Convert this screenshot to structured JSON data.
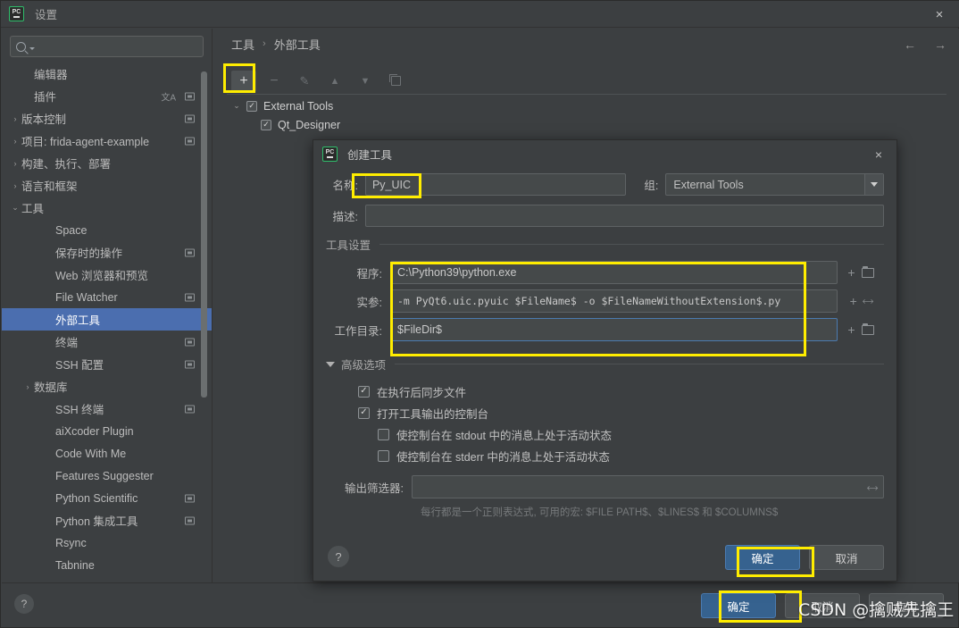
{
  "window": {
    "title": "设置",
    "logo_text": "PC",
    "close_icon": "×"
  },
  "search": {
    "value": "",
    "placeholder": ""
  },
  "sidebar": {
    "items": [
      {
        "label": "编辑器",
        "arrow": "",
        "indent": 1,
        "copy": false,
        "lang": false,
        "selected": false
      },
      {
        "label": "插件",
        "arrow": "",
        "indent": 1,
        "copy": true,
        "lang": true,
        "selected": false
      },
      {
        "label": "版本控制",
        "arrow": "›",
        "indent": 0,
        "copy": true,
        "lang": false,
        "selected": false
      },
      {
        "label": "项目: frida-agent-example",
        "arrow": "›",
        "indent": 0,
        "copy": true,
        "lang": false,
        "selected": false
      },
      {
        "label": "构建、执行、部署",
        "arrow": "›",
        "indent": 0,
        "copy": false,
        "lang": false,
        "selected": false
      },
      {
        "label": "语言和框架",
        "arrow": "›",
        "indent": 0,
        "copy": false,
        "lang": false,
        "selected": false
      },
      {
        "label": "工具",
        "arrow": "⌄",
        "indent": 0,
        "copy": false,
        "lang": false,
        "selected": false
      },
      {
        "label": "Space",
        "arrow": "",
        "indent": 2,
        "copy": false,
        "lang": false,
        "selected": false
      },
      {
        "label": "保存时的操作",
        "arrow": "",
        "indent": 2,
        "copy": true,
        "lang": false,
        "selected": false
      },
      {
        "label": "Web 浏览器和预览",
        "arrow": "",
        "indent": 2,
        "copy": false,
        "lang": false,
        "selected": false
      },
      {
        "label": "File Watcher",
        "arrow": "",
        "indent": 2,
        "copy": true,
        "lang": false,
        "selected": false
      },
      {
        "label": "外部工具",
        "arrow": "",
        "indent": 2,
        "copy": false,
        "lang": false,
        "selected": true
      },
      {
        "label": "终端",
        "arrow": "",
        "indent": 2,
        "copy": true,
        "lang": false,
        "selected": false
      },
      {
        "label": "SSH 配置",
        "arrow": "",
        "indent": 2,
        "copy": true,
        "lang": false,
        "selected": false
      },
      {
        "label": "数据库",
        "arrow": "›",
        "indent": 1,
        "copy": false,
        "lang": false,
        "selected": false
      },
      {
        "label": "SSH 终端",
        "arrow": "",
        "indent": 2,
        "copy": true,
        "lang": false,
        "selected": false
      },
      {
        "label": "aiXcoder Plugin",
        "arrow": "",
        "indent": 2,
        "copy": false,
        "lang": false,
        "selected": false
      },
      {
        "label": "Code With Me",
        "arrow": "",
        "indent": 2,
        "copy": false,
        "lang": false,
        "selected": false
      },
      {
        "label": "Features Suggester",
        "arrow": "",
        "indent": 2,
        "copy": false,
        "lang": false,
        "selected": false
      },
      {
        "label": "Python Scientific",
        "arrow": "",
        "indent": 2,
        "copy": true,
        "lang": false,
        "selected": false
      },
      {
        "label": "Python 集成工具",
        "arrow": "",
        "indent": 2,
        "copy": true,
        "lang": false,
        "selected": false
      },
      {
        "label": "Rsync",
        "arrow": "",
        "indent": 2,
        "copy": false,
        "lang": false,
        "selected": false
      },
      {
        "label": "Tabnine",
        "arrow": "",
        "indent": 2,
        "copy": false,
        "lang": false,
        "selected": false
      }
    ]
  },
  "breadcrumb": {
    "parent": "工具",
    "separator": "›",
    "current": "外部工具",
    "back_icon": "←",
    "forward_icon": "→"
  },
  "toolbar": {
    "add": "+",
    "remove": "−",
    "edit": "✎",
    "up": "▲",
    "down": "▼",
    "copy_tooltip": "copy-icon"
  },
  "tools_tree": {
    "group": {
      "label": "External Tools",
      "checked": true,
      "arrow": "⌄",
      "check_glyph": "✓"
    },
    "children": [
      {
        "label": "Qt_Designer",
        "checked": true,
        "check_glyph": "✓"
      }
    ]
  },
  "window_footer": {
    "help": "?",
    "ok": "确定",
    "cancel": "取消",
    "apply": "应用"
  },
  "dialog": {
    "title": "创建工具",
    "logo_text": "PC",
    "close_icon": "×",
    "name_label": "名称:",
    "name_value": "Py_UIC",
    "group_label": "组:",
    "group_value": "External Tools",
    "desc_label": "描述:",
    "desc_value": "",
    "tool_settings": {
      "legend": "工具设置",
      "program_label": "程序:",
      "program_value": "C:\\Python39\\python.exe",
      "arguments_label": "实参:",
      "arguments_value": "-m PyQt6.uic.pyuic $FileName$ -o $FileNameWithoutExtension$.py",
      "workdir_label": "工作目录:",
      "workdir_value": "$FileDir$",
      "add_icon": "+",
      "browse_icon": "folder-icon",
      "expand_icon": "expand-icon"
    },
    "advanced": {
      "legend": "高级选项",
      "options": [
        {
          "label": "在执行后同步文件",
          "checked": true,
          "indent": 0
        },
        {
          "label": "打开工具输出的控制台",
          "checked": true,
          "indent": 0
        },
        {
          "label": "使控制台在 stdout 中的消息上处于活动状态",
          "checked": false,
          "indent": 1
        },
        {
          "label": "使控制台在 stderr 中的消息上处于活动状态",
          "checked": false,
          "indent": 1
        }
      ],
      "filter_label": "输出筛选器:",
      "filter_value": "",
      "hint": "每行都是一个正则表达式, 可用的宏: $FILE PATH$、$LINES$ 和 $COLUMNS$"
    },
    "footer": {
      "help": "?",
      "ok": "确定",
      "cancel": "取消"
    }
  },
  "watermark": "CSDN @擒贼先擒王",
  "colors": {
    "accent_blue": "#4b6eaf",
    "primary_button": "#36628f",
    "highlight_yellow": "#ffed00",
    "background": "#3c3f41",
    "field_background": "#45494a"
  }
}
